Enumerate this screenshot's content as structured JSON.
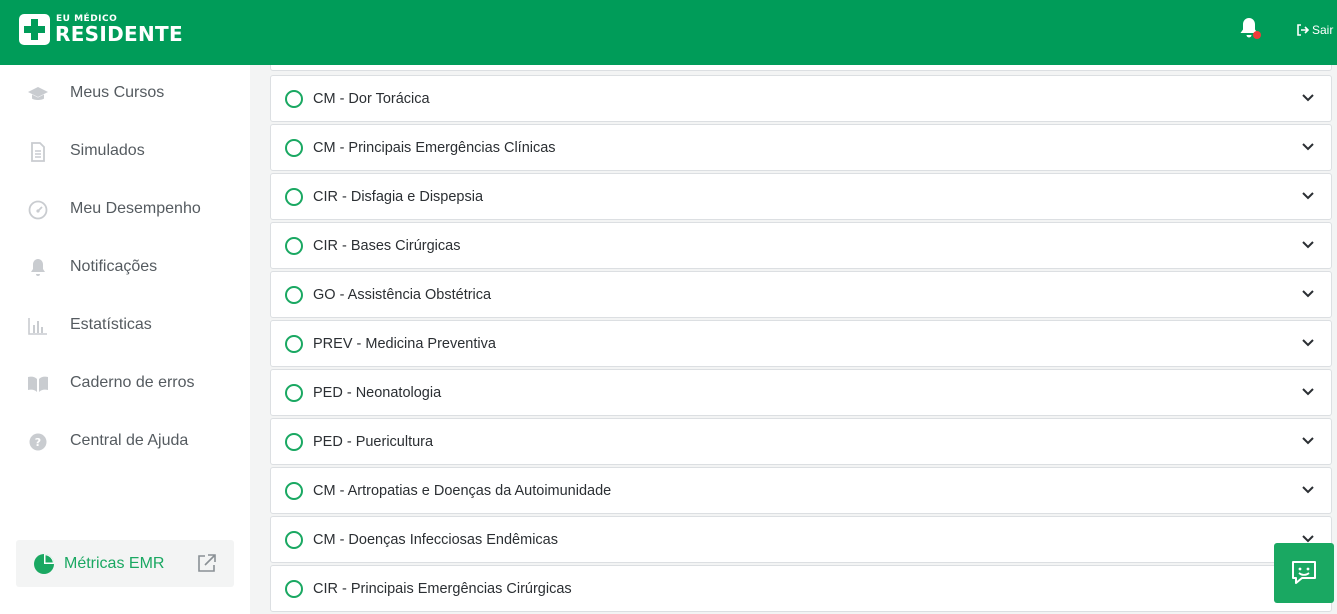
{
  "header": {
    "logo_small": "EU MÉDICO",
    "logo_main": "RESIDENTE",
    "logout_label": "Sair",
    "colors": {
      "brand": "#009c59",
      "notification_dot": "#ef3b3b"
    }
  },
  "sidebar": {
    "items": [
      {
        "label": "Meus Cursos",
        "icon": "graduation-cap-icon"
      },
      {
        "label": "Simulados",
        "icon": "document-icon"
      },
      {
        "label": "Meu Desempenho",
        "icon": "gauge-icon"
      },
      {
        "label": "Notificações",
        "icon": "bell-icon"
      },
      {
        "label": "Estatísticas",
        "icon": "bar-chart-icon"
      },
      {
        "label": "Caderno de erros",
        "icon": "book-icon"
      },
      {
        "label": "Central de Ajuda",
        "icon": "help-circle-icon"
      }
    ],
    "metrics_label": "Métricas EMR",
    "accent": "#1aa862"
  },
  "modules": [
    {
      "title": "CM - Dor Torácica"
    },
    {
      "title": "CM - Principais Emergências Clínicas"
    },
    {
      "title": "CIR - Disfagia e Dispepsia"
    },
    {
      "title": "CIR - Bases Cirúrgicas"
    },
    {
      "title": "GO - Assistência Obstétrica"
    },
    {
      "title": "PREV - Medicina Preventiva"
    },
    {
      "title": "PED - Neonatologia"
    },
    {
      "title": "PED - Puericultura"
    },
    {
      "title": "CM - Artropatias e Doenças da Autoimunidade"
    },
    {
      "title": "CM - Doenças Infecciosas Endêmicas"
    },
    {
      "title": "CIR - Principais Emergências Cirúrgicas"
    }
  ]
}
